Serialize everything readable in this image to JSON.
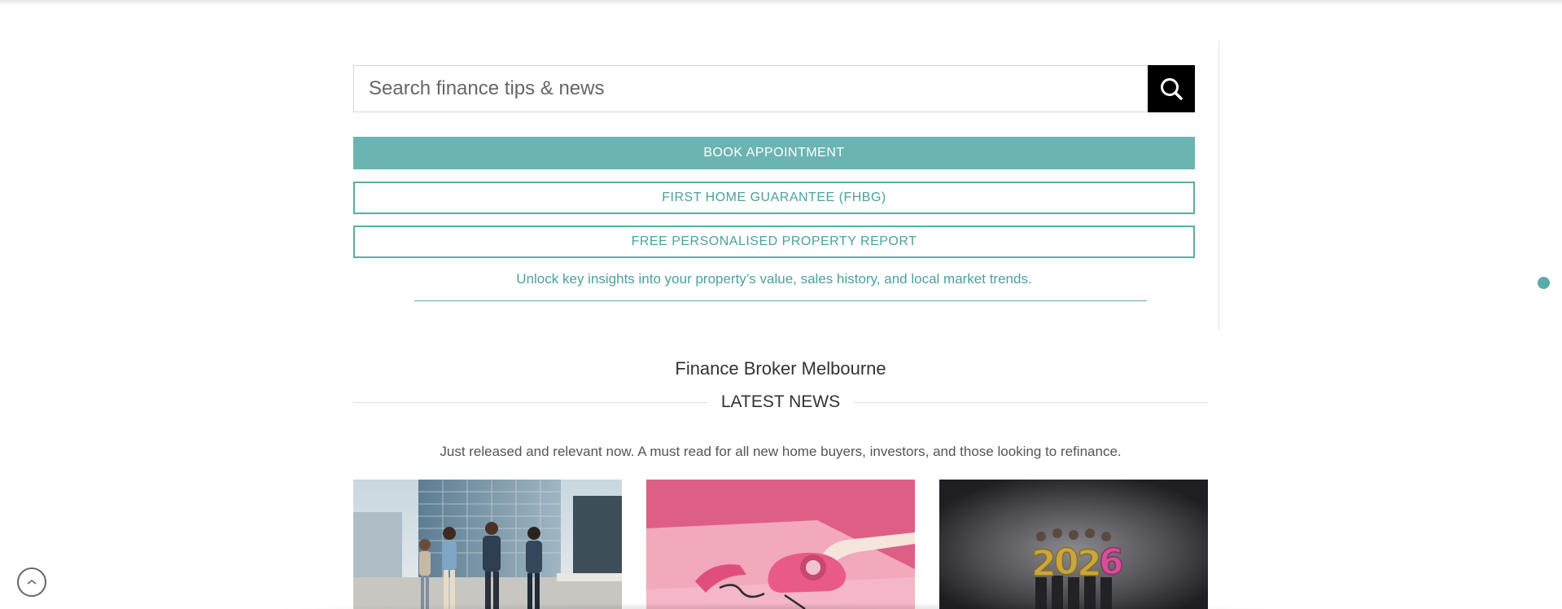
{
  "search": {
    "placeholder": "Search finance tips & news",
    "value": "",
    "button_icon": "search-icon"
  },
  "actions": {
    "book_label": "BOOK APPOINTMENT",
    "fhbg_label": "FIRST HOME GUARANTEE (FHBG)",
    "report_label": "FREE PERSONALISED PROPERTY REPORT",
    "insight_text": "Unlock key insights into your property’s value, sales history, and local market trends."
  },
  "section": {
    "title": "Finance Broker Melbourne",
    "news_heading": "LATEST NEWS",
    "news_subtitle": "Just released and relevant now. A must read for all new home buyers, investors, and those looking to refinance."
  },
  "cards": [
    {
      "image": "business-people-walking-photo"
    },
    {
      "image": "pink-rotary-phone-photo"
    },
    {
      "image": "2026-balloons-group-photo"
    }
  ],
  "colors": {
    "accent": "#6cb4b1",
    "accent_text": "#4aa19d",
    "search_button": "#000000"
  },
  "icons": {
    "back_to_top": "chevron-up-icon",
    "scroll_indicator": "dot-indicator"
  }
}
